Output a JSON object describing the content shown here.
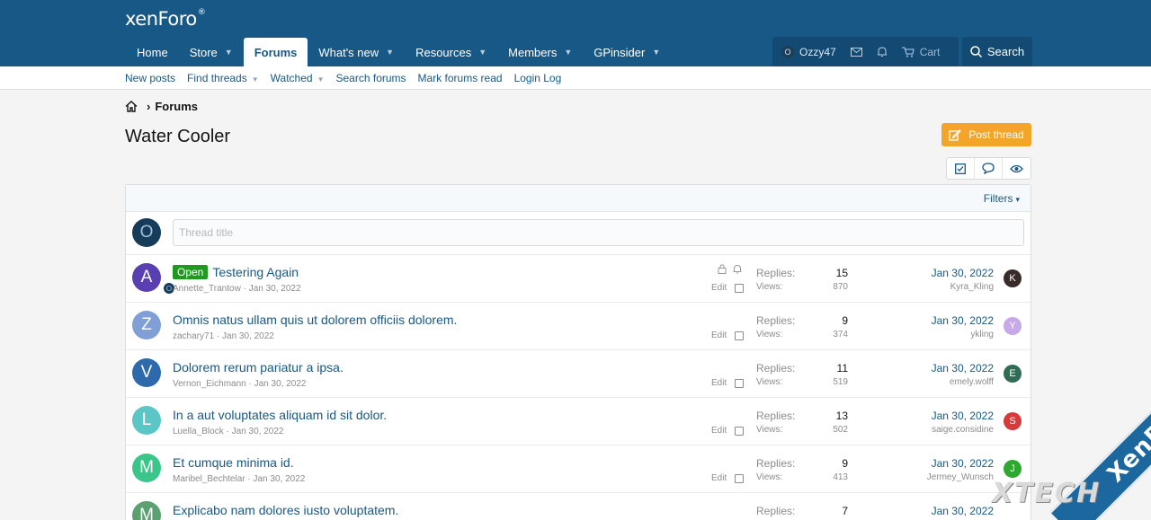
{
  "logo": "xenForo",
  "nav": {
    "tabs": [
      {
        "label": "Home",
        "caret": false,
        "active": false
      },
      {
        "label": "Store",
        "caret": true,
        "active": false
      },
      {
        "label": "Forums",
        "caret": false,
        "active": true
      },
      {
        "label": "What's new",
        "caret": true,
        "active": false
      },
      {
        "label": "Resources",
        "caret": true,
        "active": false
      },
      {
        "label": "Members",
        "caret": true,
        "active": false
      },
      {
        "label": "GPinsider",
        "caret": true,
        "active": false
      }
    ],
    "user": {
      "avatar_letter": "O",
      "name": "Ozzy47"
    },
    "cart_label": "Cart",
    "search_label": "Search"
  },
  "subnav": [
    {
      "label": "New posts",
      "caret": false
    },
    {
      "label": "Find threads",
      "caret": true
    },
    {
      "label": "Watched",
      "caret": true
    },
    {
      "label": "Search forums",
      "caret": false
    },
    {
      "label": "Mark forums read",
      "caret": false
    },
    {
      "label": "Login Log",
      "caret": false
    }
  ],
  "breadcrumb": {
    "current": "Forums"
  },
  "page_title": "Water Cooler",
  "post_thread_label": "Post thread",
  "filters_label": "Filters",
  "quick_thread": {
    "avatar_letter": "O",
    "placeholder": "Thread title"
  },
  "labels": {
    "replies": "Replies:",
    "views": "Views:",
    "edit": "Edit"
  },
  "threads": [
    {
      "avatar": "A",
      "avatar_color": "#5a3fb2",
      "prefix": "Open",
      "title": "Testering Again",
      "author": "Annette_Trantow",
      "date": "Jan 30, 2022",
      "replies": "15",
      "views": "870",
      "last_date": "Jan 30, 2022",
      "last_user": "Kyra_Kling",
      "last_avatar": "K",
      "last_avatar_color": "#3a2a2a",
      "locked": true
    },
    {
      "avatar": "Z",
      "avatar_color": "#7f9fd6",
      "prefix": "",
      "title": "Omnis natus ullam quis ut dolorem officiis dolorem.",
      "author": "zachary71",
      "date": "Jan 30, 2022",
      "replies": "9",
      "views": "374",
      "last_date": "Jan 30, 2022",
      "last_user": "ykling",
      "last_avatar": "Y",
      "last_avatar_color": "#c7a8e8",
      "locked": false
    },
    {
      "avatar": "V",
      "avatar_color": "#2e6aab",
      "prefix": "",
      "title": "Dolorem rerum pariatur a ipsa.",
      "author": "Vernon_Eichmann",
      "date": "Jan 30, 2022",
      "replies": "11",
      "views": "519",
      "last_date": "Jan 30, 2022",
      "last_user": "emely.wolff",
      "last_avatar": "E",
      "last_avatar_color": "#2f6b55",
      "locked": false
    },
    {
      "avatar": "L",
      "avatar_color": "#5cc6c6",
      "prefix": "",
      "title": "In a aut voluptates aliquam id sit dolor.",
      "author": "Luella_Block",
      "date": "Jan 30, 2022",
      "replies": "13",
      "views": "502",
      "last_date": "Jan 30, 2022",
      "last_user": "saige.considine",
      "last_avatar": "S",
      "last_avatar_color": "#d43b3b",
      "locked": false
    },
    {
      "avatar": "M",
      "avatar_color": "#3ac68a",
      "prefix": "",
      "title": "Et cumque minima id.",
      "author": "Maribel_Bechtelar",
      "date": "Jan 30, 2022",
      "replies": "9",
      "views": "413",
      "last_date": "Jan 30, 2022",
      "last_user": "Jermey_Wunsch",
      "last_avatar": "J",
      "last_avatar_color": "#2ea82e",
      "locked": false
    },
    {
      "avatar": "M",
      "avatar_color": "#5aa070",
      "prefix": "",
      "title": "Explicabo nam dolores iusto voluptatem.",
      "author": "",
      "date": "",
      "replies": "7",
      "views": "",
      "last_date": "Jan 30, 2022",
      "last_user": "",
      "last_avatar": "",
      "last_avatar_color": "#ffffff",
      "locked": false
    }
  ],
  "watermark": {
    "band": "XenBD.Com",
    "text": "XTECH"
  }
}
